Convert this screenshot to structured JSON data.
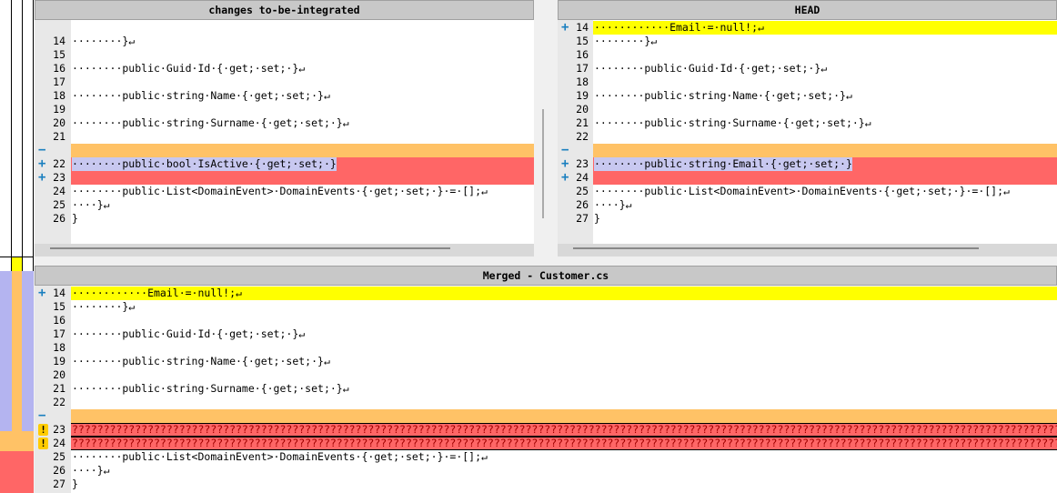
{
  "panes": {
    "left_title": "changes to-be-integrated",
    "right_title": "HEAD",
    "merged_title": "Merged - Customer.cs"
  },
  "left": {
    "rows": [
      {
        "n": "14",
        "text": "········}↵"
      },
      {
        "n": "15",
        "text": ""
      },
      {
        "n": "16",
        "text": "········public·Guid·Id·{·get;·set;·}↵"
      },
      {
        "n": "17",
        "text": ""
      },
      {
        "n": "18",
        "text": "········public·string·Name·{·get;·set;·}↵"
      },
      {
        "n": "19",
        "text": ""
      },
      {
        "n": "20",
        "text": "········public·string·Surname·{·get;·set;·}↵"
      },
      {
        "n": "21",
        "text": ""
      },
      {
        "n": "",
        "text": "",
        "marker": "−"
      },
      {
        "n": "22",
        "text": "········public·bool·IsActive·{·get;·set;·}",
        "marker": "+"
      },
      {
        "n": "23",
        "text": "",
        "marker": "+"
      },
      {
        "n": "24",
        "text": "········public·List<DomainEvent>·DomainEvents·{·get;·set;·}·=·[];↵"
      },
      {
        "n": "25",
        "text": "····}↵"
      },
      {
        "n": "26",
        "text": "}"
      }
    ]
  },
  "right": {
    "rows": [
      {
        "n": "14",
        "text": "············Email·=·null!;↵",
        "marker": "+"
      },
      {
        "n": "15",
        "text": "········}↵"
      },
      {
        "n": "16",
        "text": ""
      },
      {
        "n": "17",
        "text": "········public·Guid·Id·{·get;·set;·}↵"
      },
      {
        "n": "18",
        "text": ""
      },
      {
        "n": "19",
        "text": "········public·string·Name·{·get;·set;·}↵"
      },
      {
        "n": "20",
        "text": ""
      },
      {
        "n": "21",
        "text": "········public·string·Surname·{·get;·set;·}↵"
      },
      {
        "n": "22",
        "text": ""
      },
      {
        "n": "",
        "text": "",
        "marker": "−"
      },
      {
        "n": "23",
        "text": "········public·string·Email·{·get;·set;·}",
        "marker": "+"
      },
      {
        "n": "24",
        "text": "",
        "marker": "+"
      },
      {
        "n": "25",
        "text": "········public·List<DomainEvent>·DomainEvents·{·get;·set;·}·=·[];↵"
      },
      {
        "n": "26",
        "text": "····}↵"
      },
      {
        "n": "27",
        "text": "}"
      }
    ]
  },
  "merged": {
    "rows": [
      {
        "n": "14",
        "text": "············Email·=·null!;↵",
        "marker": "+"
      },
      {
        "n": "15",
        "text": "········}↵"
      },
      {
        "n": "16",
        "text": ""
      },
      {
        "n": "17",
        "text": "········public·Guid·Id·{·get;·set;·}↵"
      },
      {
        "n": "18",
        "text": ""
      },
      {
        "n": "19",
        "text": "········public·string·Name·{·get;·set;·}↵"
      },
      {
        "n": "20",
        "text": ""
      },
      {
        "n": "21",
        "text": "········public·string·Surname·{·get;·set;·}↵"
      },
      {
        "n": "22",
        "text": ""
      },
      {
        "n": "",
        "text": "",
        "marker": "−"
      },
      {
        "n": "23",
        "text": "??????????????????????????????????????????????????????????????????????????????????????????????????????????????????????????????????????????????????????????????????????????????????????????????????????????????????",
        "marker": "!"
      },
      {
        "n": "24",
        "text": "??????????????????????????????????????????????????????????????????????????????????????????????????????????????????????????????????????????????????????????????????????????????????????????????????????????????????",
        "marker": "!"
      },
      {
        "n": "25",
        "text": "········public·List<DomainEvent>·DomainEvents·{·get;·set;·}·=·[];↵"
      },
      {
        "n": "26",
        "text": "····}↵"
      },
      {
        "n": "27",
        "text": "}"
      }
    ]
  },
  "colors": {
    "added": "#ffff00",
    "removed_band": "#ffc266",
    "conflict": "#ff6666",
    "selection": "#c8c8f0",
    "marker": "#1a7fbf"
  }
}
